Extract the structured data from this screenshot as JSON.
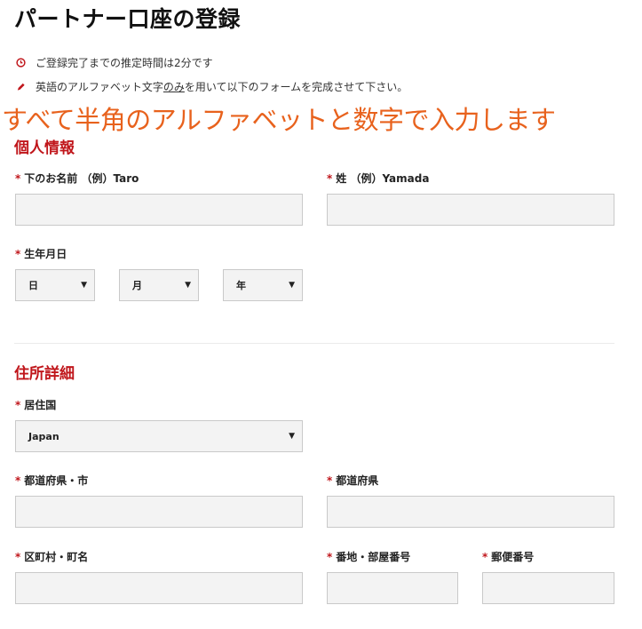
{
  "page": {
    "title": "パートナー口座の登録"
  },
  "notes": [
    {
      "icon": "clock-icon",
      "text": "ご登録完了までの推定時間は2分です"
    },
    {
      "icon": "pencil-icon",
      "text_before": "英語のアルファベット文字",
      "text_underlined": "のみ",
      "text_after": "を用いて以下のフォームを完成させて下さい。"
    }
  ],
  "overlay_annotation": "すべて半角のアルファベットと数字で入力します",
  "personal": {
    "heading": "個人情報",
    "first_name_label": "下のお名前 （例）Taro",
    "last_name_label": "姓 （例）Yamada",
    "dob_label": "生年月日",
    "day_select": "日",
    "month_select": "月",
    "year_select": "年"
  },
  "address": {
    "heading": "住所詳細",
    "country_label": "居住国",
    "country_value": "Japan",
    "city_label": "都道府県・市",
    "prefecture_label": "都道府県",
    "district_label": "区町村・町名",
    "street_label": "番地・部屋番号",
    "postal_label": "郵便番号"
  },
  "required_mark": "*",
  "colors": {
    "accent": "#c0161b",
    "overlay": "#e8621d",
    "field_bg": "#f3f3f3",
    "field_border": "#c9c9c9"
  }
}
